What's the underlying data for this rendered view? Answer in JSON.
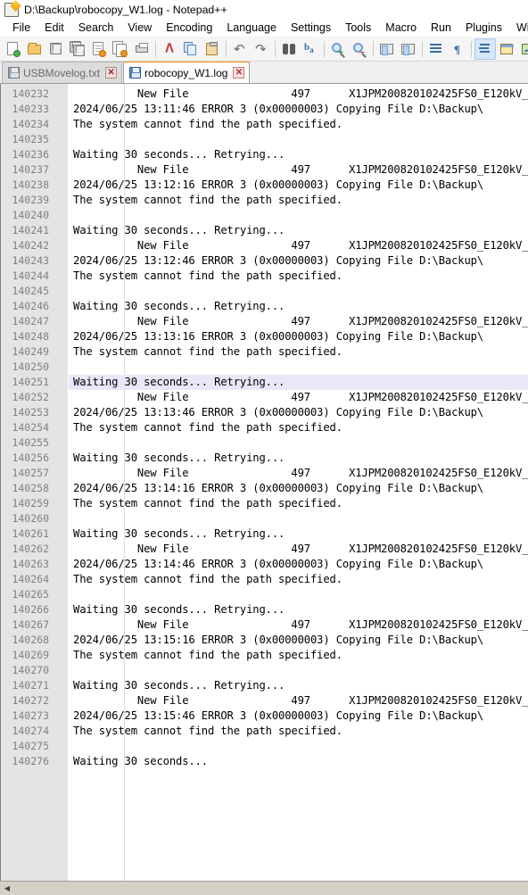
{
  "window": {
    "title": "D:\\Backup\\robocopy_W1.log - Notepad++",
    "app_icon": "notepad-plus-plus-icon"
  },
  "menubar": {
    "items": [
      {
        "label": "File"
      },
      {
        "label": "Edit"
      },
      {
        "label": "Search"
      },
      {
        "label": "View"
      },
      {
        "label": "Encoding"
      },
      {
        "label": "Language"
      },
      {
        "label": "Settings"
      },
      {
        "label": "Tools"
      },
      {
        "label": "Macro"
      },
      {
        "label": "Run"
      },
      {
        "label": "Plugins"
      },
      {
        "label": "Window"
      },
      {
        "label": "?"
      }
    ]
  },
  "toolbar": {
    "buttons": [
      {
        "icon": "new-file-icon",
        "active": false
      },
      {
        "icon": "open-file-icon",
        "active": false
      },
      {
        "icon": "save-icon",
        "active": false
      },
      {
        "icon": "save-all-icon",
        "active": false
      },
      {
        "icon": "close-file-icon",
        "active": false
      },
      {
        "icon": "close-all-files-icon",
        "active": false
      },
      {
        "icon": "print-icon",
        "active": false
      },
      {
        "icon": "separator",
        "active": false
      },
      {
        "icon": "cut-icon",
        "active": false
      },
      {
        "icon": "copy-icon",
        "active": false
      },
      {
        "icon": "paste-icon",
        "active": false
      },
      {
        "icon": "separator",
        "active": false
      },
      {
        "icon": "undo-icon",
        "active": false
      },
      {
        "icon": "redo-icon",
        "active": false
      },
      {
        "icon": "separator",
        "active": false
      },
      {
        "icon": "find-icon",
        "active": false
      },
      {
        "icon": "replace-icon",
        "active": false
      },
      {
        "icon": "separator",
        "active": false
      },
      {
        "icon": "zoom-in-icon",
        "active": false
      },
      {
        "icon": "zoom-out-icon",
        "active": false
      },
      {
        "icon": "separator",
        "active": false
      },
      {
        "icon": "sync-vertical-scroll-icon",
        "active": false
      },
      {
        "icon": "sync-horizontal-scroll-icon",
        "active": false
      },
      {
        "icon": "separator",
        "active": false
      },
      {
        "icon": "word-wrap-icon",
        "active": false
      },
      {
        "icon": "show-all-characters-icon",
        "active": false
      },
      {
        "icon": "separator",
        "active": false
      },
      {
        "icon": "indent-guideline-icon",
        "active": true
      },
      {
        "icon": "user-defined-dialog-icon",
        "active": false
      },
      {
        "icon": "document-map-icon",
        "active": false
      },
      {
        "icon": "function-list-icon",
        "active": false
      }
    ]
  },
  "tabs": [
    {
      "label": "USBMovelog.txt",
      "icon": "floppy-icon",
      "close_glyph": "✕",
      "active": false
    },
    {
      "label": "robocopy_W1.log",
      "icon": "floppy-icon",
      "close_glyph": "✕",
      "active": true
    }
  ],
  "editor": {
    "first_line_number": 140232,
    "current_line_number": 140251,
    "lines": [
      {
        "n": 140232,
        "text": "          New File                497      X1JPM200820102425FS0_E120kV_"
      },
      {
        "n": 140233,
        "text": "2024/06/25 13:11:46 ERROR 3 (0x00000003) Copying File D:\\Backup\\"
      },
      {
        "n": 140234,
        "text": "The system cannot find the path specified."
      },
      {
        "n": 140235,
        "text": ""
      },
      {
        "n": 140236,
        "text": "Waiting 30 seconds... Retrying..."
      },
      {
        "n": 140237,
        "text": "          New File                497      X1JPM200820102425FS0_E120kV_"
      },
      {
        "n": 140238,
        "text": "2024/06/25 13:12:16 ERROR 3 (0x00000003) Copying File D:\\Backup\\"
      },
      {
        "n": 140239,
        "text": "The system cannot find the path specified."
      },
      {
        "n": 140240,
        "text": ""
      },
      {
        "n": 140241,
        "text": "Waiting 30 seconds... Retrying..."
      },
      {
        "n": 140242,
        "text": "          New File                497      X1JPM200820102425FS0_E120kV_"
      },
      {
        "n": 140243,
        "text": "2024/06/25 13:12:46 ERROR 3 (0x00000003) Copying File D:\\Backup\\"
      },
      {
        "n": 140244,
        "text": "The system cannot find the path specified."
      },
      {
        "n": 140245,
        "text": ""
      },
      {
        "n": 140246,
        "text": "Waiting 30 seconds... Retrying..."
      },
      {
        "n": 140247,
        "text": "          New File                497      X1JPM200820102425FS0_E120kV_"
      },
      {
        "n": 140248,
        "text": "2024/06/25 13:13:16 ERROR 3 (0x00000003) Copying File D:\\Backup\\"
      },
      {
        "n": 140249,
        "text": "The system cannot find the path specified."
      },
      {
        "n": 140250,
        "text": ""
      },
      {
        "n": 140251,
        "text": "Waiting 30 seconds... Retrying..."
      },
      {
        "n": 140252,
        "text": "          New File                497      X1JPM200820102425FS0_E120kV_"
      },
      {
        "n": 140253,
        "text": "2024/06/25 13:13:46 ERROR 3 (0x00000003) Copying File D:\\Backup\\"
      },
      {
        "n": 140254,
        "text": "The system cannot find the path specified."
      },
      {
        "n": 140255,
        "text": ""
      },
      {
        "n": 140256,
        "text": "Waiting 30 seconds... Retrying..."
      },
      {
        "n": 140257,
        "text": "          New File                497      X1JPM200820102425FS0_E120kV_"
      },
      {
        "n": 140258,
        "text": "2024/06/25 13:14:16 ERROR 3 (0x00000003) Copying File D:\\Backup\\"
      },
      {
        "n": 140259,
        "text": "The system cannot find the path specified."
      },
      {
        "n": 140260,
        "text": ""
      },
      {
        "n": 140261,
        "text": "Waiting 30 seconds... Retrying..."
      },
      {
        "n": 140262,
        "text": "          New File                497      X1JPM200820102425FS0_E120kV_"
      },
      {
        "n": 140263,
        "text": "2024/06/25 13:14:46 ERROR 3 (0x00000003) Copying File D:\\Backup\\"
      },
      {
        "n": 140264,
        "text": "The system cannot find the path specified."
      },
      {
        "n": 140265,
        "text": ""
      },
      {
        "n": 140266,
        "text": "Waiting 30 seconds... Retrying..."
      },
      {
        "n": 140267,
        "text": "          New File                497      X1JPM200820102425FS0_E120kV_"
      },
      {
        "n": 140268,
        "text": "2024/06/25 13:15:16 ERROR 3 (0x00000003) Copying File D:\\Backup\\"
      },
      {
        "n": 140269,
        "text": "The system cannot find the path specified."
      },
      {
        "n": 140270,
        "text": ""
      },
      {
        "n": 140271,
        "text": "Waiting 30 seconds... Retrying..."
      },
      {
        "n": 140272,
        "text": "          New File                497      X1JPM200820102425FS0_E120kV_"
      },
      {
        "n": 140273,
        "text": "2024/06/25 13:15:46 ERROR 3 (0x00000003) Copying File D:\\Backup\\"
      },
      {
        "n": 140274,
        "text": "The system cannot find the path specified."
      },
      {
        "n": 140275,
        "text": ""
      },
      {
        "n": 140276,
        "text": "Waiting 30 seconds..."
      }
    ]
  },
  "scrollbar": {
    "left_arrow_glyph": "◀"
  },
  "colors": {
    "accent_tab_active": "#ff8c00",
    "gutter_bg": "#e4e4e4",
    "gutter_text": "#808080",
    "current_line_bg": "#e8e8f8",
    "editor_bg": "#ffffff",
    "toolbar_bg": "#f5f5f5",
    "chrome_bg": "#f0f0f0"
  }
}
